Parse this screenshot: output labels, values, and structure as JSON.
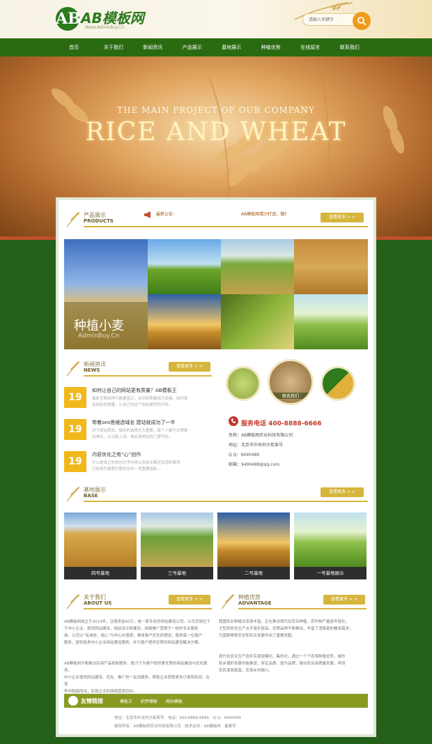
{
  "header": {
    "logo_letters": "AB",
    "logo_name": "AB模板网",
    "logo_sub": "Www.AdminBuy.Cn",
    "search_placeholder": "请输入关键字"
  },
  "nav": [
    "首页",
    "关于我们",
    "新闻资讯",
    "产品展示",
    "基地展示",
    "种植优势",
    "在线留言",
    "联系我们"
  ],
  "banner": {
    "subtitle": "THE MAIN PROJECT OF OUR COMPANY",
    "title": "RICE AND WHEAT"
  },
  "notice": {
    "label": "最新公告：",
    "text": "AB模板网竭力打造，做F"
  },
  "products": {
    "cn": "产品展示",
    "en": "PRODUCTS",
    "more": "查看更多 > >",
    "big_cn": "种植小麦",
    "big_en": "AdminBuy.Cn"
  },
  "news": {
    "cn": "新闻资讯",
    "en": "NEWS",
    "more": "查看更多 > >",
    "items": [
      {
        "day": "19",
        "title": "如何让自己的网站更有质量？AB模板王",
        "desc1": "最新互联网排行数据显示，访问的质量成为关键，如何提",
        "desc2": "高网站的质量，让自己的这个网站更好的开拓..."
      },
      {
        "day": "19",
        "title": "带着seo思维选域名 建站就成功了一半",
        "desc1": "对于网站来说，域名的选择尤为重要，每个人都不太想更",
        "desc2": "改域名，从功能上讲，域名是网站的门牌号码..."
      },
      {
        "day": "19",
        "title": "内容优化之有“心”创作",
        "desc1": "什么是真正的原创文字内容以及站长都应知道的事项",
        "desc2": "已经成为搜索引擎优化的一项重要指标..."
      }
    ]
  },
  "circles": {
    "middle_label": "联系我们"
  },
  "contact": {
    "phone_label": "服务电话",
    "phone": "400-8888-6666",
    "lines": [
      "名称：AB模板网农业科技有限公司",
      "地址：北京市中关村大街某号",
      "Q Q：9490489",
      "邮箱：9490489@qq.com"
    ]
  },
  "base": {
    "cn": "基地展示",
    "en": "BASE",
    "more": "查看更多 > >",
    "items": [
      "四号基地",
      "三号基地",
      "二号基地",
      "一号基地展示"
    ]
  },
  "about": {
    "cn": "关于我们",
    "en": "ABOUT US",
    "more": "查看更多 > >",
    "p1": [
      "AB模板网成立于2014年，注册资金60万，是一家专业的网站建设公司。公司总部位于",
      "于中小企业，提供网站建设，网站设计和建设，网络推广营销于一体的专业服务",
      "商。公司以“有诚信、用心”为中心价值观，秉承客户优先的理念，服务每一位客户",
      "服务，提供各类中小企业网站建设服务，并为客户提供优质的网站建设解决方案。"
    ],
    "p2": [
      "AB模板网不断推出实用产品和新服务，致力于为客户提供更优质的网站建设与优化服务，",
      "中小企业提供网站建设、优化、推广的一站式服务，帮助企业获取更多订单和利润，在竞",
      "争中脱颖而出，实现企业的网络营销目标。"
    ]
  },
  "advantage": {
    "cn": "种植优势",
    "en": "ADVANTAGE",
    "more": "查看更多 > >",
    "p1": [
      "我国农业种植业资源丰富，正在推动现代化农业种植，农作物产量逐年增长，",
      "大型农机化生产水平逐步提高，优质品种不断推出，丰富了消费者的餐桌需求，",
      "为国家粮食安全和农业发展作出了重要贡献。"
    ],
    "p2": [
      "现代化农业生产逐步实现规模化、集约化，通过一个个农场种植优势，城市",
      "和乡镇的发展均衡推进，保证品质，提升品牌，推动农业高质量发展，带领",
      "农民增收致富，实现乡村振兴。"
    ]
  },
  "links": {
    "title": "友情链接",
    "items": [
      "模板王",
      "织梦模板",
      "网站模板"
    ]
  },
  "footer": {
    "line1": "地址：北京市中关村大街某号　电话：400-8888-6666　Q Q：9490489",
    "line2": "版权所有：AB模板网农业科技有限公司　技术支持：AB模板网　备案号"
  },
  "colors": {
    "nav_green": "#2a6b12",
    "accent_gold": "#d6b53c",
    "date_yellow": "#f1b81b",
    "phone_red": "#c0392b",
    "search_orange": "#f09a1c"
  }
}
